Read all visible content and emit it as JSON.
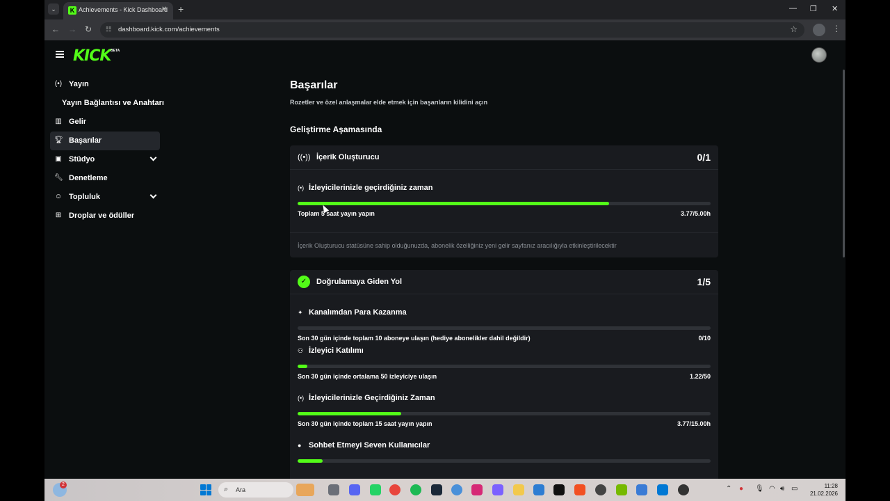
{
  "browser": {
    "tab_title": "Achievements - Kick Dashboard",
    "url": "dashboard.kick.com/achievements"
  },
  "header": {
    "logo": "KICK",
    "logo_badge": "BETA"
  },
  "sidebar": {
    "items": [
      {
        "label": "Yayın",
        "icon": "broadcast-icon"
      },
      {
        "label": "Yayın Bağlantısı ve Anahtarı",
        "icon": ""
      },
      {
        "label": "Gelir",
        "icon": "chart-icon"
      },
      {
        "label": "Başarılar",
        "icon": "trophy-icon",
        "active": true
      },
      {
        "label": "Stüdyo",
        "icon": "studio-icon",
        "expandable": true
      },
      {
        "label": "Denetleme",
        "icon": "wrench-icon"
      },
      {
        "label": "Topluluk",
        "icon": "community-icon",
        "expandable": true
      },
      {
        "label": "Droplar ve ödüller",
        "icon": "gift-icon"
      }
    ]
  },
  "main": {
    "title": "Başarılar",
    "subtitle": "Rozetler ve özel anlaşmalar elde etmek için başarıların kilidini açın",
    "section_title": "Geliştirme Aşamasında",
    "cards": [
      {
        "title": "İçerik Oluşturucu",
        "count": "0/1",
        "icon": "broadcast-icon",
        "tasks": [
          {
            "title": "İzleyicilerinizle geçirdiğiniz zaman",
            "desc": "Toplam 5 saat yayın yapın",
            "value": "3.77/5.00h",
            "progress": 0.754
          }
        ],
        "note": "İçerik Oluşturucu statüsüne sahip olduğunuzda, abonelik özelliğiniz yeni gelir sayfanız aracılığıyla etkinleştirilecektir"
      },
      {
        "title": "Doğrulamaya Giden Yol",
        "count": "1/5",
        "icon": "verified-badge-icon",
        "tasks": [
          {
            "title": "Kanalımdan Para Kazanma",
            "desc": "Son 30 gün içinde toplam 10 aboneye ulaşın (hediye abonelikler dahil değildir)",
            "value": "0/10",
            "progress": 0.0
          },
          {
            "title": "İzleyici Katılımı",
            "desc": "Son 30 gün içinde ortalama 50 izleyiciye ulaşın",
            "value": "1.22/50",
            "progress": 0.024
          },
          {
            "title": "İzleyicilerinizle Geçirdiğiniz Zaman",
            "desc": "Son 30 gün içinde toplam 15 saat yayın yapın",
            "value": "3.77/15.00h",
            "progress": 0.251
          },
          {
            "title": "Sohbet Etmeyi Seven Kullanıcılar",
            "desc": "",
            "value": "",
            "progress": 0.06
          }
        ]
      }
    ]
  },
  "taskbar": {
    "search_placeholder": "Ara",
    "weather_badge": "2",
    "time": "11:28",
    "date": "21.02.2026"
  },
  "colors": {
    "accent": "#53fc18",
    "page_bg": "#0b0e0f",
    "card_bg": "#191b1f"
  }
}
